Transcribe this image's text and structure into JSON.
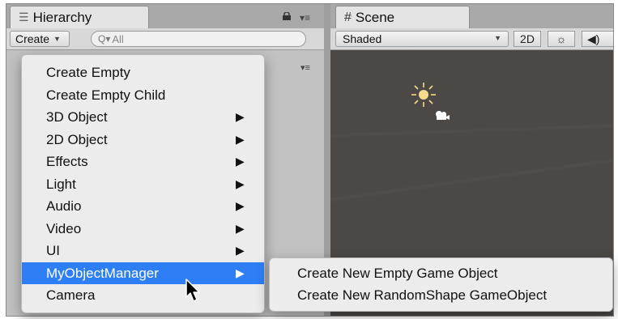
{
  "hierarchy": {
    "tab_title": "Hierarchy",
    "create_label": "Create",
    "search_placeholder": "All"
  },
  "scene": {
    "tab_title": "Scene",
    "shading_mode": "Shaded",
    "mode_2d_label": "2D"
  },
  "icons": {
    "hierarchy_tab": "list-icon",
    "scene_tab": "grid-hash-icon",
    "lock": "lock-icon",
    "search": "search-icon",
    "light": "sun-icon",
    "audio": "speaker-icon",
    "camera": "camera-gizmo-icon",
    "cursor": "mouse-pointer-icon"
  },
  "create_menu": {
    "items": [
      {
        "label": "Create Empty",
        "has_submenu": false
      },
      {
        "label": "Create Empty Child",
        "has_submenu": false
      },
      {
        "label": "3D Object",
        "has_submenu": true
      },
      {
        "label": "2D Object",
        "has_submenu": true
      },
      {
        "label": "Effects",
        "has_submenu": true
      },
      {
        "label": "Light",
        "has_submenu": true
      },
      {
        "label": "Audio",
        "has_submenu": true
      },
      {
        "label": "Video",
        "has_submenu": true
      },
      {
        "label": "UI",
        "has_submenu": true
      },
      {
        "label": "MyObjectManager",
        "has_submenu": true,
        "highlighted": true
      },
      {
        "label": "Camera",
        "has_submenu": false
      }
    ]
  },
  "submenu": {
    "items": [
      {
        "label": "Create New Empty Game Object"
      },
      {
        "label": "Create New RandomShape GameObject"
      }
    ]
  },
  "colors": {
    "highlight": "#2e7ff5",
    "scene_background": "#4b4846",
    "menu_background": "#ececec"
  }
}
